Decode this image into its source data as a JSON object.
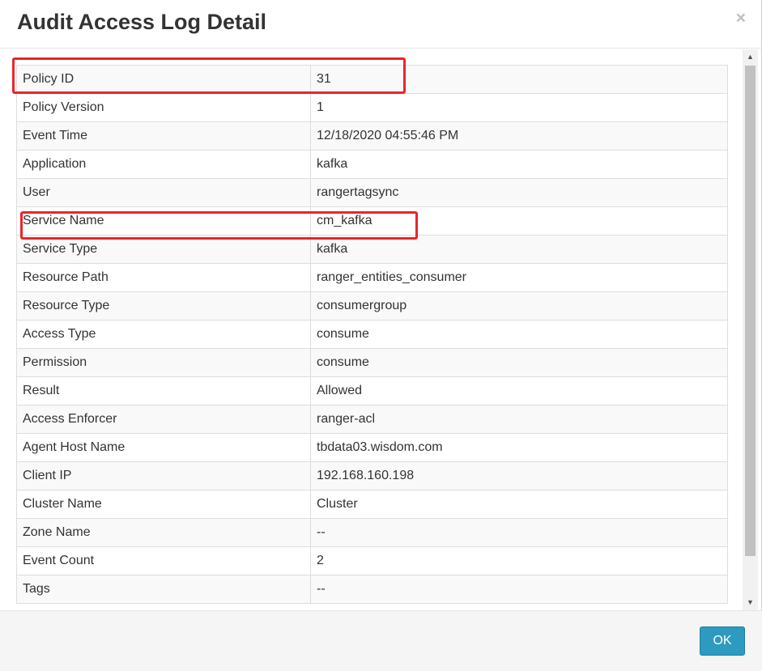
{
  "dialog": {
    "title": "Audit Access Log Detail",
    "close_label": "×",
    "ok_label": "OK"
  },
  "rows": [
    {
      "label": "Policy ID",
      "value": "31"
    },
    {
      "label": "Policy Version",
      "value": "1"
    },
    {
      "label": "Event Time",
      "value": "12/18/2020 04:55:46 PM"
    },
    {
      "label": "Application",
      "value": "kafka"
    },
    {
      "label": "User",
      "value": "rangertagsync"
    },
    {
      "label": "Service Name",
      "value": "cm_kafka"
    },
    {
      "label": "Service Type",
      "value": "kafka"
    },
    {
      "label": "Resource Path",
      "value": "ranger_entities_consumer"
    },
    {
      "label": "Resource Type",
      "value": "consumergroup"
    },
    {
      "label": "Access Type",
      "value": "consume"
    },
    {
      "label": "Permission",
      "value": "consume"
    },
    {
      "label": "Result",
      "value": "Allowed"
    },
    {
      "label": "Access Enforcer",
      "value": "ranger-acl"
    },
    {
      "label": "Agent Host Name",
      "value": "tbdata03.wisdom.com"
    },
    {
      "label": "Client IP",
      "value": "192.168.160.198"
    },
    {
      "label": "Cluster Name",
      "value": "Cluster"
    },
    {
      "label": "Zone Name",
      "value": "--"
    },
    {
      "label": "Event Count",
      "value": "2"
    },
    {
      "label": "Tags",
      "value": "--"
    }
  ],
  "colors": {
    "highlight": "#e8262b",
    "ok_button": "#2d9bc0"
  },
  "icons": {
    "close": "close-icon",
    "scroll_up": "scroll-up-arrow-icon",
    "scroll_down": "scroll-down-arrow-icon"
  }
}
